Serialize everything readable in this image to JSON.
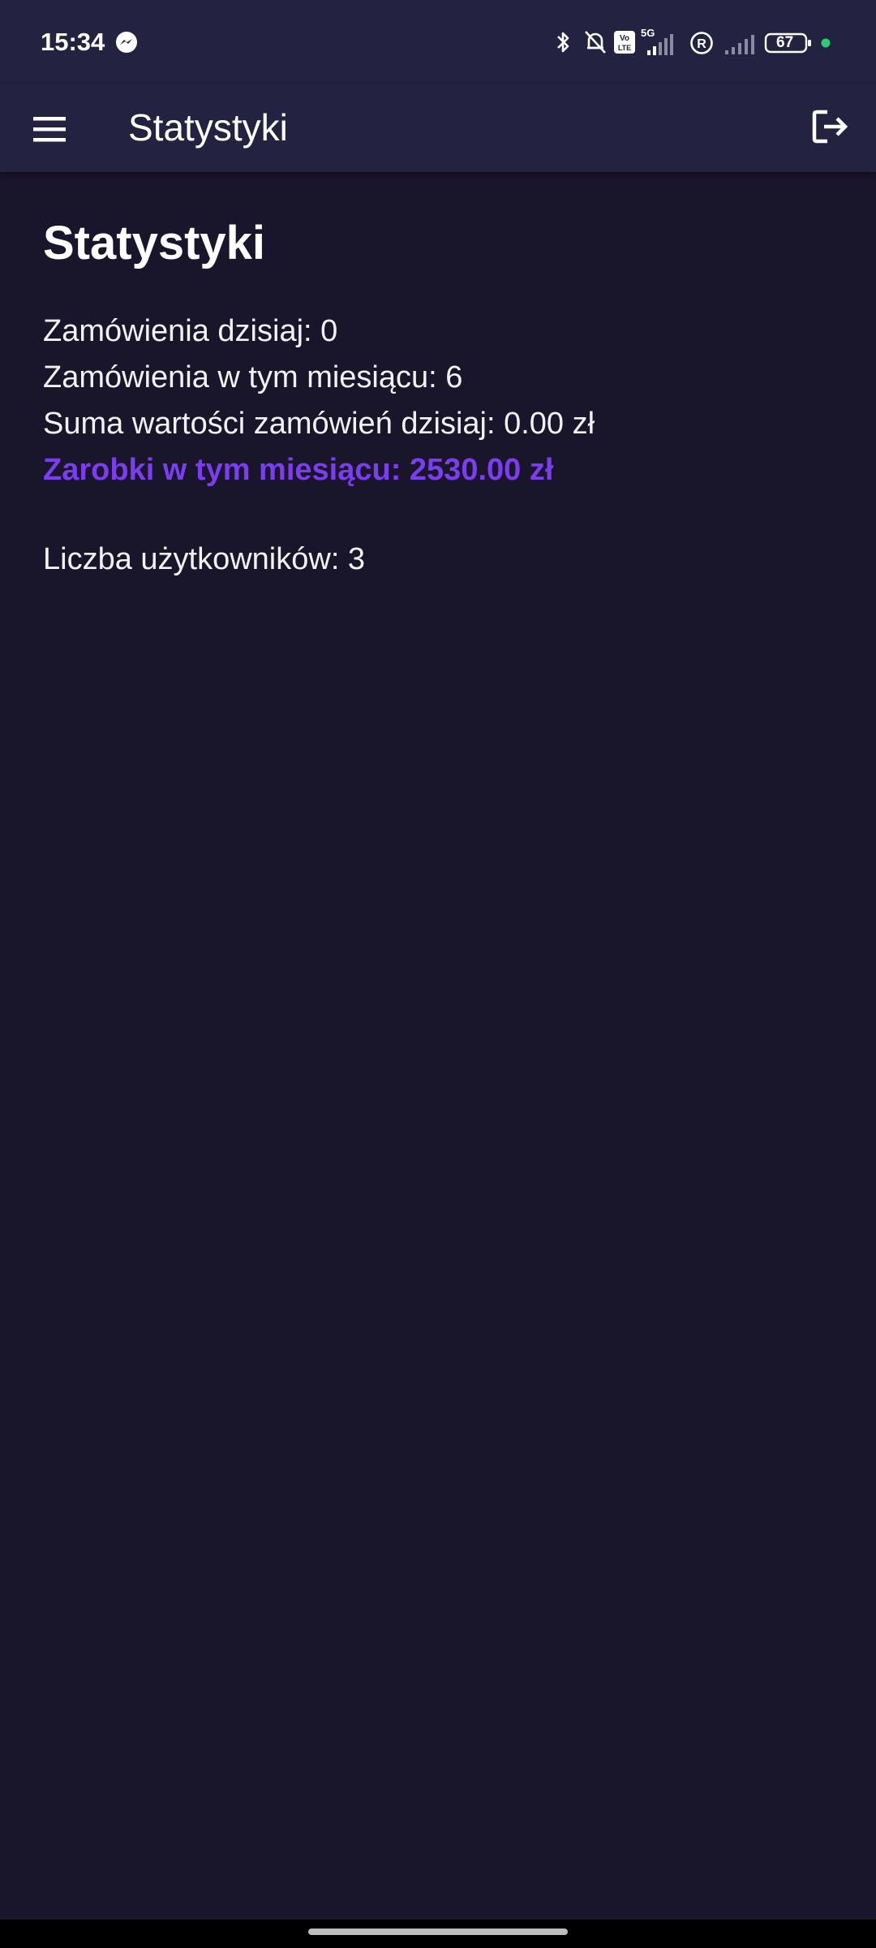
{
  "status_bar": {
    "time": "15:34",
    "battery_level": "67",
    "notification_icon": "messenger-icon",
    "indicators": [
      "bluetooth-icon",
      "mute-icon",
      "volte-icon",
      "5g-signal-icon",
      "roaming-icon",
      "signal-icon",
      "battery-icon"
    ],
    "battery_dot_color": "#2ecc71"
  },
  "app_bar": {
    "title": "Statystyki",
    "menu_icon": "menu-icon",
    "logout_icon": "logout-icon"
  },
  "main": {
    "heading": "Statystyki",
    "stats": {
      "orders_today": "Zamówienia dzisiaj: 0",
      "orders_month": "Zamówienia w tym miesiącu: 6",
      "sum_today": "Suma wartości zamówień dzisiaj: 0.00 zł",
      "earnings_month": "Zarobki w tym miesiącu: 2530.00 zł",
      "users_count": "Liczba użytkowników: 3"
    }
  },
  "colors": {
    "background": "#19152a",
    "app_bar": "#232241",
    "accent": "#7c3cf0",
    "text": "#f2f2f6"
  }
}
